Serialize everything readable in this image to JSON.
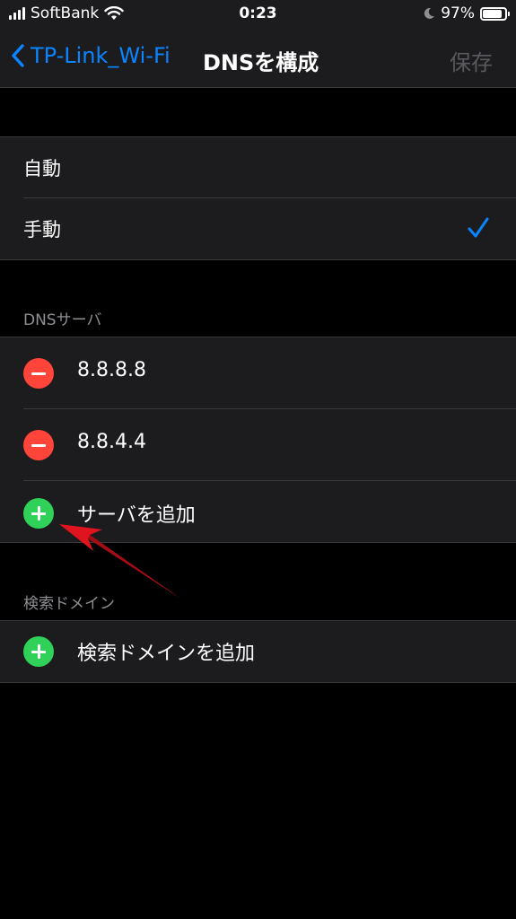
{
  "status_bar": {
    "carrier": "SoftBank",
    "time": "0:23",
    "battery_percent": "97%",
    "battery_level": 0.97
  },
  "nav": {
    "back_label": "TP-Link_Wi-Fi",
    "title": "DNSを構成",
    "save_label": "保存"
  },
  "mode": {
    "options": [
      {
        "label": "自動",
        "selected": false
      },
      {
        "label": "手動",
        "selected": true
      }
    ]
  },
  "dns_servers": {
    "header": "DNSサーバ",
    "servers": [
      "8.8.8.8",
      "8.8.4.4"
    ],
    "add_label": "サーバを追加"
  },
  "search_domains": {
    "header": "検索ドメイン",
    "add_label": "検索ドメインを追加"
  },
  "colors": {
    "accent": "#0a84ff",
    "delete": "#ff453a",
    "add": "#30d158",
    "annotation_arrow": "#e0141e"
  }
}
